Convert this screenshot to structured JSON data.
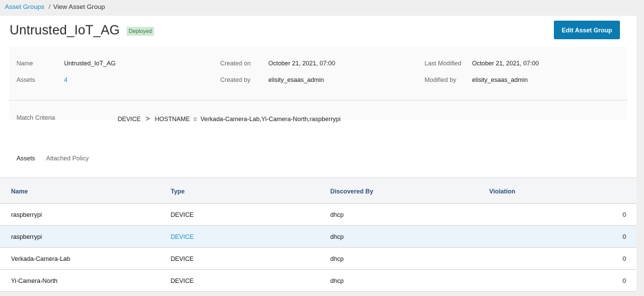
{
  "breadcrumb": {
    "root": "Asset Groups",
    "separator": "/",
    "current": "View Asset Group"
  },
  "header": {
    "title": "Untrusted_IoT_AG",
    "status_badge": "Deployed",
    "edit_button": "Edit Asset Group"
  },
  "details": {
    "name_label": "Name",
    "name_value": "Untrusted_IoT_AG",
    "assets_label": "Assets",
    "assets_value": "4",
    "created_on_label": "Created on",
    "created_on_value": "October 21, 2021, 07:00",
    "created_by_label": "Created by",
    "created_by_value": "elisity_esaas_admin",
    "last_modified_label": "Last Modified",
    "last_modified_value": "October 21, 2021, 07:00",
    "modified_by_label": "Modified by",
    "modified_by_value": "elisity_esaas_admin",
    "match_criteria_label": "Match Criteria",
    "match_criteria": {
      "category": "DEVICE",
      "chevron": ">",
      "attribute": "HOSTNAME",
      "operator": "=",
      "values": "Verkada-Camera-Lab,Yi-Camera-North,raspberrypi"
    }
  },
  "tabs": [
    {
      "label": "Assets"
    },
    {
      "label": "Attached Policy"
    }
  ],
  "table": {
    "columns": [
      "Name",
      "Type",
      "Discovered By",
      "Violation"
    ],
    "rows": [
      {
        "name": "raspberrypi",
        "type": "DEVICE",
        "discovered_by": "dhcp",
        "violation": "0"
      },
      {
        "name": "raspberrypi",
        "type": "DEVICE",
        "discovered_by": "dhcp",
        "violation": "0"
      },
      {
        "name": "Verkada-Camera-Lab",
        "type": "DEVICE",
        "discovered_by": "dhcp",
        "violation": "0"
      },
      {
        "name": "Yi-Camera-North",
        "type": "DEVICE",
        "discovered_by": "dhcp",
        "violation": "0"
      }
    ]
  },
  "colors": {
    "accent": "#0b7cb1",
    "link": "#1a8fc6",
    "badge_bg": "#cfead3",
    "selected_row": "#ebf4fb"
  }
}
